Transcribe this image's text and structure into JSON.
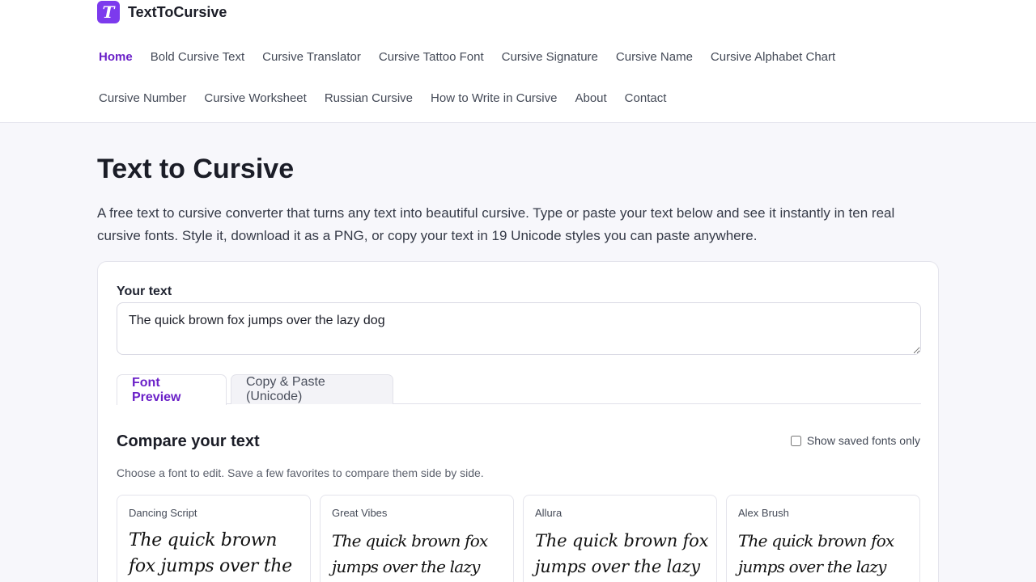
{
  "brand": {
    "name": "TextToCursive",
    "logo_letter": "T"
  },
  "nav": {
    "row1": [
      "Home",
      "Bold Cursive Text",
      "Cursive Translator",
      "Cursive Tattoo Font",
      "Cursive Signature",
      "Cursive Name",
      "Cursive Alphabet Chart"
    ],
    "row2": [
      "Cursive Number",
      "Cursive Worksheet",
      "Russian Cursive",
      "How to Write in Cursive",
      "About",
      "Contact"
    ],
    "active": "Home"
  },
  "hero": {
    "title": "Text to Cursive",
    "intro": "A free text to cursive converter that turns any text into beautiful cursive. Type or paste your text below and see it instantly in ten real cursive fonts. Style it, download it as a PNG, or copy your text in 19 Unicode styles you can paste anywhere."
  },
  "input": {
    "label": "Your text",
    "value": "The quick brown fox jumps over the lazy dog"
  },
  "tabs": {
    "font_preview": "Font Preview",
    "copy_paste": "Copy & Paste (Unicode)"
  },
  "compare": {
    "title": "Compare your text",
    "saved_only_label": "Show saved fonts only",
    "hint": "Choose a font to edit. Save a few favorites to compare them side by side."
  },
  "fonts": [
    {
      "name": "Dancing Script",
      "sample": "The quick brown fox jumps over the lazy dog"
    },
    {
      "name": "Great Vibes",
      "sample": "The quick brown fox jumps over the lazy dog"
    },
    {
      "name": "Allura",
      "sample": "The quick brown fox jumps over the lazy dog"
    },
    {
      "name": "Alex Brush",
      "sample": "The quick brown fox jumps over the lazy dog"
    }
  ],
  "colors": {
    "accent": "#6b21c8",
    "logo_bg": "#7c3aed",
    "page_bg": "#f7f7fb"
  }
}
